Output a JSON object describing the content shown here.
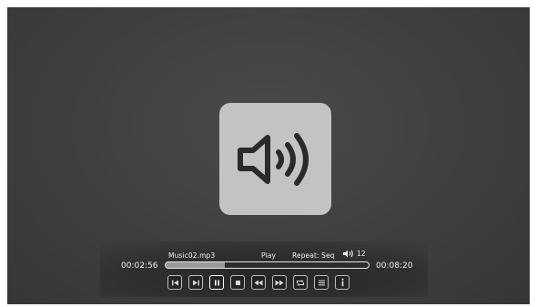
{
  "player": {
    "filename": "Music02.mp3",
    "state": "Play",
    "repeat": "Repeat: Seq",
    "volume": "12",
    "elapsed": "00:02:56",
    "total": "00:08:20",
    "progress_fraction": 0.29
  },
  "media_icon": "speaker-icon",
  "controls": [
    {
      "name": "previous-track-button",
      "icon": "skip-previous-icon"
    },
    {
      "name": "next-track-button",
      "icon": "skip-next-icon"
    },
    {
      "name": "pause-button",
      "icon": "pause-icon",
      "active": true
    },
    {
      "name": "stop-button",
      "icon": "stop-icon"
    },
    {
      "name": "rewind-button",
      "icon": "rewind-icon"
    },
    {
      "name": "fast-forward-button",
      "icon": "fast-forward-icon"
    },
    {
      "name": "repeat-button",
      "icon": "repeat-icon"
    },
    {
      "name": "playlist-button",
      "icon": "list-icon"
    },
    {
      "name": "info-button",
      "icon": "info-icon"
    }
  ],
  "colors": {
    "background": "#404040",
    "tile": "#c3c3c3",
    "text": "#f2f2f2",
    "progress_fill": "#9a9a9a"
  }
}
